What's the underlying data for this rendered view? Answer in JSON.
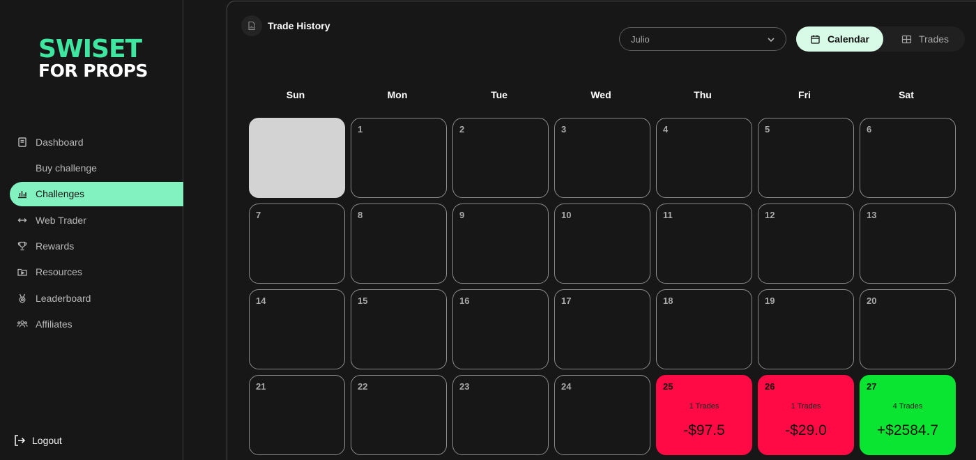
{
  "brand": {
    "line1": "SWISET",
    "line2": "FOR PROPS"
  },
  "sidebar": {
    "items": [
      {
        "label": "Dashboard",
        "icon": "dashboard-icon"
      },
      {
        "label": "Buy challenge",
        "icon": ""
      },
      {
        "label": "Challenges",
        "icon": "bar-chart-icon",
        "active": true
      },
      {
        "label": "Web Trader",
        "icon": "arrows-horizontal-icon"
      },
      {
        "label": "Rewards",
        "icon": "trophy-icon"
      },
      {
        "label": "Resources",
        "icon": "folder-play-icon"
      },
      {
        "label": "Leaderboard",
        "icon": "medal-icon"
      },
      {
        "label": "Affiliates",
        "icon": "users-icon"
      }
    ],
    "logout": "Logout"
  },
  "header": {
    "title": "Trade History",
    "month": "Julio",
    "toggle": {
      "calendar": "Calendar",
      "trades": "Trades"
    }
  },
  "calendar": {
    "weekdays": [
      "Sun",
      "Mon",
      "Tue",
      "Wed",
      "Thu",
      "Fri",
      "Sat"
    ],
    "days": [
      {
        "day": "",
        "status": "blank"
      },
      {
        "day": "1"
      },
      {
        "day": "2"
      },
      {
        "day": "3"
      },
      {
        "day": "4"
      },
      {
        "day": "5"
      },
      {
        "day": "6"
      },
      {
        "day": "7"
      },
      {
        "day": "8"
      },
      {
        "day": "9"
      },
      {
        "day": "10"
      },
      {
        "day": "11"
      },
      {
        "day": "12"
      },
      {
        "day": "13"
      },
      {
        "day": "14"
      },
      {
        "day": "15"
      },
      {
        "day": "16"
      },
      {
        "day": "17"
      },
      {
        "day": "18"
      },
      {
        "day": "19"
      },
      {
        "day": "20"
      },
      {
        "day": "21"
      },
      {
        "day": "22"
      },
      {
        "day": "23"
      },
      {
        "day": "24"
      },
      {
        "day": "25",
        "status": "loss",
        "trades": "1 Trades",
        "pnl": "-$97.5"
      },
      {
        "day": "26",
        "status": "loss",
        "trades": "1 Trades",
        "pnl": "-$29.0"
      },
      {
        "day": "27",
        "status": "gain",
        "trades": "4 Trades",
        "pnl": "+$2584.7"
      }
    ]
  },
  "colors": {
    "accent": "#3ee6a0",
    "active_nav": "#82f2c1",
    "loss": "#ff0a44",
    "gain": "#0ae532",
    "blank": "#d3d3d3"
  }
}
